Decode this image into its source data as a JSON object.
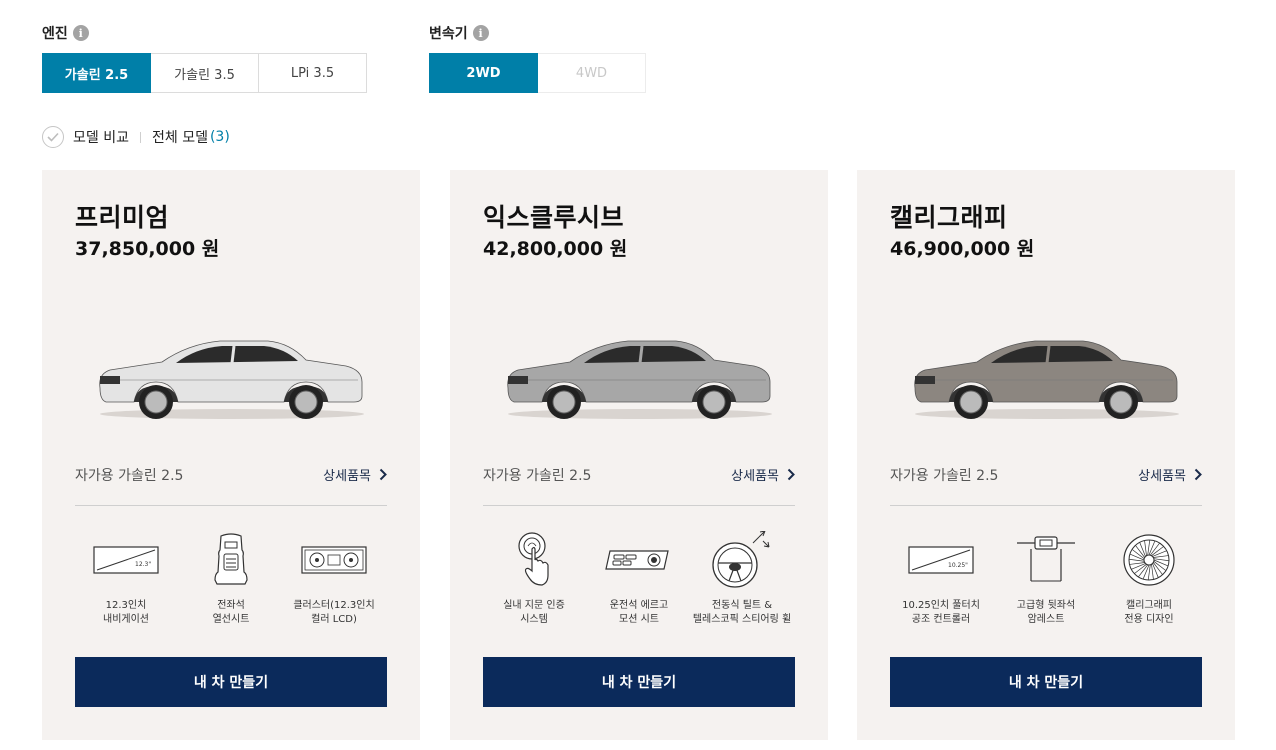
{
  "filters": {
    "engine": {
      "label": "엔진",
      "info_icon": "i",
      "options": [
        "가솔린 2.5",
        "가솔린 3.5",
        "LPi 3.5"
      ],
      "selected": "가솔린 2.5"
    },
    "drive": {
      "label": "변속기",
      "info_icon": "i",
      "options": [
        "2WD",
        "4WD"
      ],
      "selected": "2WD",
      "disabled": "4WD"
    }
  },
  "compare": {
    "label": "모델 비교",
    "all_models_label": "전체 모델",
    "count": "(3)"
  },
  "colors": {
    "accent": "#007fa8",
    "cta": "#0b2a5b",
    "card_bg": "#f5f2f0"
  },
  "cards": [
    {
      "name": "프리미엄",
      "price": "37,850,000 원",
      "car_color": "#e4e4e4",
      "spec": "자가용 가솔린 2.5",
      "detail_label": "상세품목",
      "features": [
        {
          "icon": "navigation-screen-icon",
          "screen_label": "12.3\"",
          "label": "12.3인치\n내비게이션"
        },
        {
          "icon": "heated-seat-icon",
          "label": "전좌석\n열선시트"
        },
        {
          "icon": "cluster-lcd-icon",
          "label": "클러스터(12.3인치\n컬러 LCD)"
        }
      ],
      "cta": "내 차 만들기"
    },
    {
      "name": "익스클루시브",
      "price": "42,800,000 원",
      "car_color": "#a7a7a7",
      "spec": "자가용 가솔린 2.5",
      "detail_label": "상세품목",
      "features": [
        {
          "icon": "fingerprint-auth-icon",
          "label": "실내 지문 인증\n시스템"
        },
        {
          "icon": "ergo-seat-switch-icon",
          "label": "운전석 에르고\n모션 시트"
        },
        {
          "icon": "tilt-steering-icon",
          "label": "전동식 틸트 &\n텔레스코픽 스티어링 휠"
        }
      ],
      "cta": "내 차 만들기"
    },
    {
      "name": "캘리그래피",
      "price": "46,900,000 원",
      "car_color": "#8c8680",
      "spec": "자가용 가솔린 2.5",
      "detail_label": "상세품목",
      "features": [
        {
          "icon": "fulltouch-controller-icon",
          "screen_label": "10.25\"",
          "label": "10.25인치 풀터치\n공조 컨트롤러"
        },
        {
          "icon": "rear-armrest-icon",
          "label": "고급형 뒷좌석\n암레스트"
        },
        {
          "icon": "calligraphy-wheel-icon",
          "label": "캘리그래피\n전용 디자인"
        }
      ],
      "cta": "내 차 만들기"
    }
  ]
}
